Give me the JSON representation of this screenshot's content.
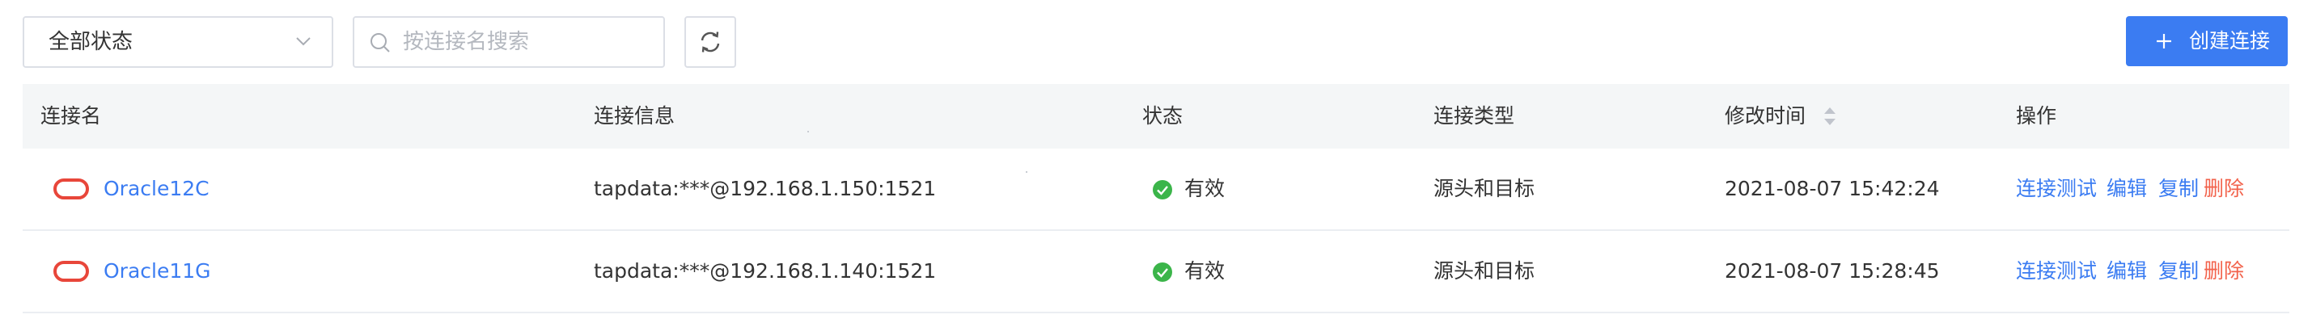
{
  "toolbar": {
    "status_filter": "全部状态",
    "search_placeholder": "按连接名搜索",
    "create_label": "创建连接"
  },
  "table": {
    "headers": [
      "连接名",
      "连接信息",
      "状态",
      "连接类型",
      "修改时间",
      "操作"
    ],
    "rows": [
      {
        "name": "Oracle12C",
        "info": "tapdata:***@192.168.1.150:1521",
        "status": "有效",
        "type": "源头和目标",
        "modified": "2021-08-07 15:42:24"
      },
      {
        "name": "Oracle11G",
        "info": "tapdata:***@192.168.1.140:1521",
        "status": "有效",
        "type": "源头和目标",
        "modified": "2021-08-07 15:28:45"
      }
    ],
    "actions": {
      "test": "连接测试",
      "edit": "编辑",
      "copy": "复制",
      "delete": "删除"
    }
  },
  "colors": {
    "primary": "#3b7cf2",
    "danger": "#f2624b",
    "success": "#3bb54a",
    "oracle": "#e8463a",
    "header_bg": "#f4f6f7"
  }
}
